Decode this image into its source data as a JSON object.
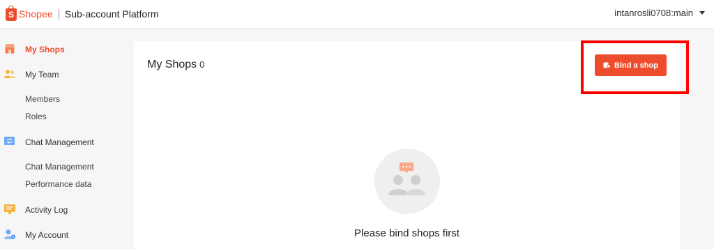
{
  "header": {
    "logo_letter": "S",
    "logo_text": "Shopee",
    "platform_title": "Sub-account Platform",
    "username": "intanrosli0708:main"
  },
  "sidebar": {
    "items": [
      {
        "label": "My Shops",
        "icon": "shop-icon",
        "active": true
      },
      {
        "label": "My Team",
        "icon": "team-icon",
        "children": [
          "Members",
          "Roles"
        ]
      },
      {
        "label": "Chat Management",
        "icon": "chat-icon",
        "children": [
          "Chat Management",
          "Performance data"
        ]
      },
      {
        "label": "Activity Log",
        "icon": "activity-log-icon"
      },
      {
        "label": "My Account",
        "icon": "account-icon"
      }
    ]
  },
  "main": {
    "title": "My Shops",
    "count": "0",
    "bind_button_label": "Bind a shop",
    "empty_message": "Please bind shops first"
  },
  "colors": {
    "brand": "#ee4d2d",
    "highlight": "#ff0000",
    "active_nav": "#ee4d2d"
  }
}
